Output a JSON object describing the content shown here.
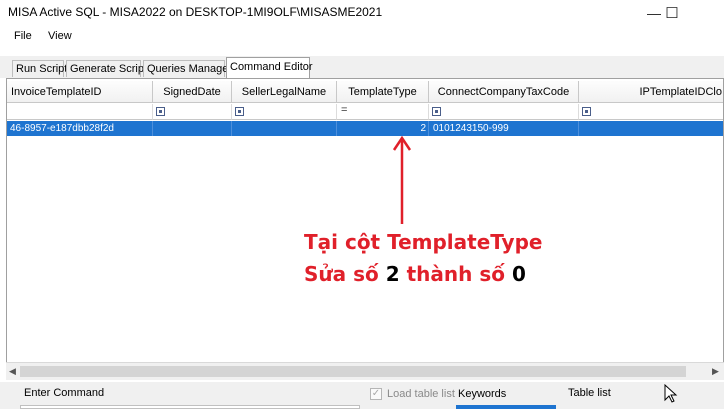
{
  "window": {
    "title": "MISA Active SQL - MISA2022 on DESKTOP-1MI9OLF\\MISASME2021",
    "minimize": "—",
    "maximize": "☐"
  },
  "menu": [
    "File",
    "View"
  ],
  "tabs": [
    "Run Script",
    "Generate Script",
    "Queries Manager",
    "Command Editor"
  ],
  "active_tab": "Command Editor",
  "grid": {
    "columns": [
      "InvoiceTemplateID",
      "SignedDate",
      "SellerLegalName",
      "TemplateType",
      "ConnectCompanyTaxCode",
      "IPTemplateIDClo"
    ],
    "filter_symbol": "=",
    "row": [
      "46-8957-e187dbb28f2d",
      "",
      "",
      "2",
      "0101243150-999",
      ""
    ]
  },
  "annotation": {
    "line1": "Tại cột TemplateType",
    "line2_a": "Sửa số ",
    "line2_b": "2",
    "line2_c": " thành số ",
    "line2_d": "0",
    "color": "#e0202a"
  },
  "bottom": {
    "enter_command": "Enter Command",
    "load_table_list": "Load table list",
    "keywords": "Keywords",
    "table_list": "Table list",
    "checkmark": "✓"
  }
}
